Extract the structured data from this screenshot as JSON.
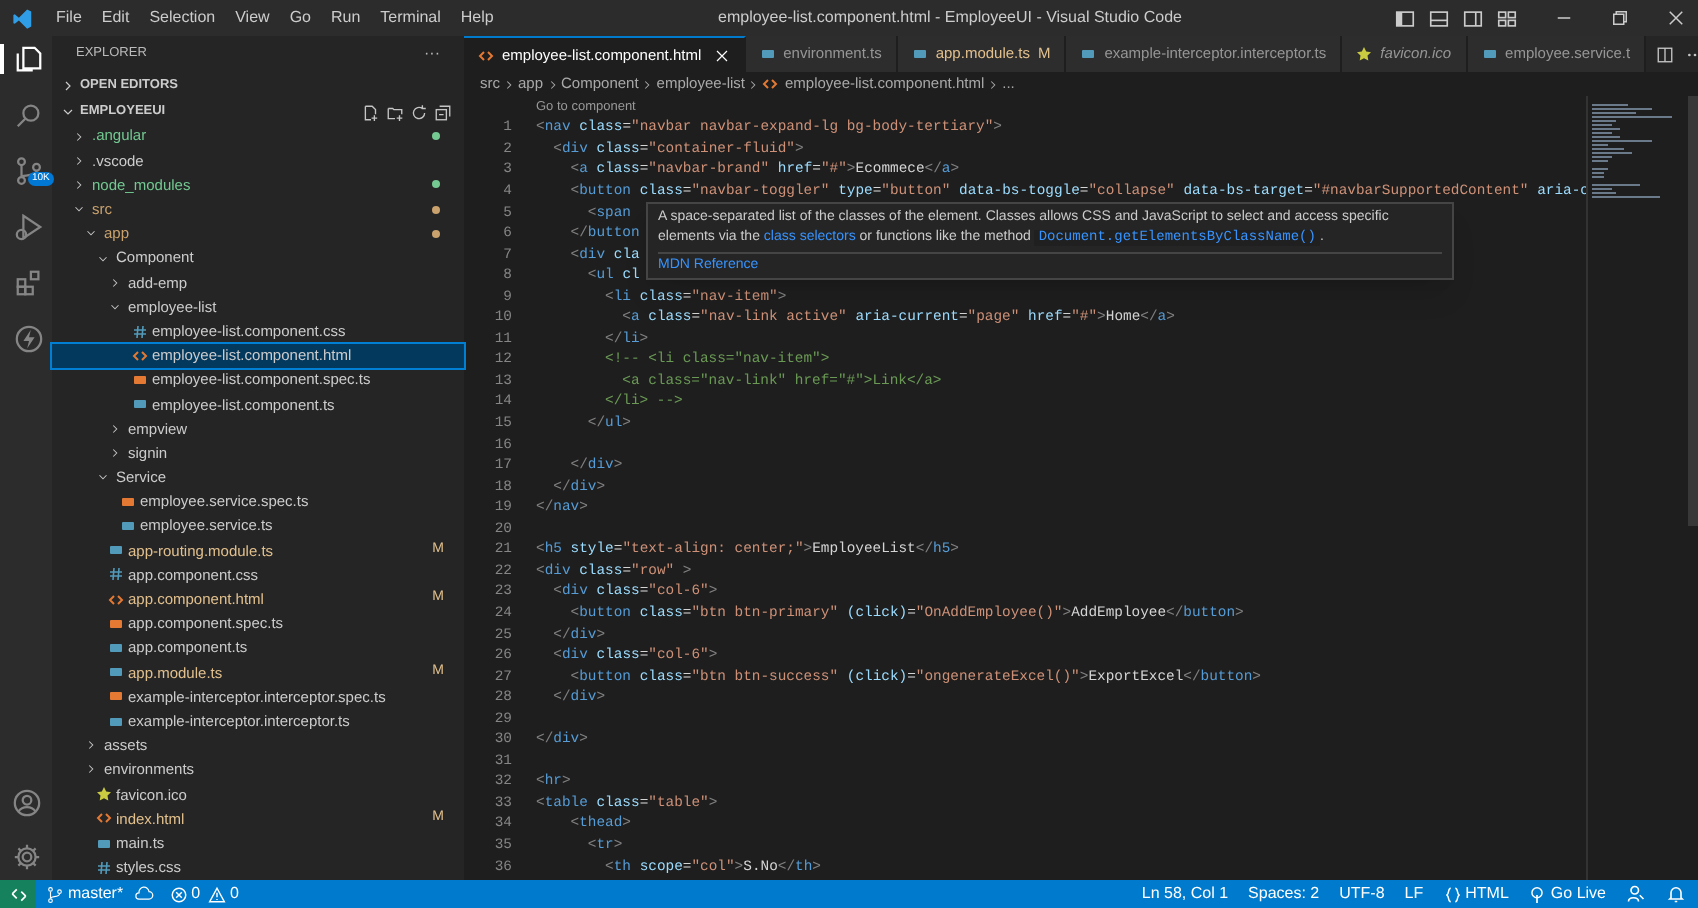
{
  "menu": [
    "File",
    "Edit",
    "Selection",
    "View",
    "Go",
    "Run",
    "Terminal",
    "Help"
  ],
  "window": {
    "title": "employee-list.component.html - EmployeeUI - Visual Studio Code"
  },
  "activity_bar": {
    "items": [
      {
        "selected": true
      },
      {
        "selected": false
      },
      {
        "selected": false,
        "badge": "10K"
      },
      {
        "selected": false
      },
      {
        "selected": false
      },
      {
        "selected": false
      }
    ]
  },
  "sidebar": {
    "title": "EXPLORER",
    "more": "···",
    "sections": [
      {
        "label": "OPEN EDITORS",
        "expanded": false
      },
      {
        "label": "EMPLOYEEUI",
        "expanded": true
      }
    ],
    "tree": [
      {
        "label": ".angular",
        "kind": "folder",
        "expanded": false,
        "color": "#73c991",
        "dot": true
      },
      {
        "label": ".vscode",
        "kind": "folder",
        "expanded": false
      },
      {
        "label": "node_modules",
        "kind": "folder",
        "expanded": false,
        "color": "#73c991",
        "dot": true
      },
      {
        "label": "src",
        "kind": "folder",
        "expanded": true,
        "color": "#c9a26d",
        "dot": true,
        "children": [
          {
            "label": "app",
            "kind": "folder",
            "expanded": true,
            "color": "#c9a26d",
            "dot": true,
            "children": [
              {
                "label": "Component",
                "kind": "folder",
                "expanded": true,
                "children": [
                  {
                    "label": "add-emp",
                    "kind": "folder",
                    "expanded": false
                  },
                  {
                    "label": "employee-list",
                    "kind": "folder",
                    "expanded": true,
                    "children": [
                      {
                        "label": "employee-list.component.css",
                        "kind": "css",
                        "selected": false
                      },
                      {
                        "label": "employee-list.component.html",
                        "kind": "html",
                        "selected": true
                      },
                      {
                        "label": "employee-list.component.spec.ts",
                        "kind": "spec",
                        "selected": false
                      },
                      {
                        "label": "employee-list.component.ts",
                        "kind": "ts",
                        "selected": false
                      }
                    ]
                  },
                  {
                    "label": "empview",
                    "kind": "folder",
                    "expanded": false
                  },
                  {
                    "label": "signin",
                    "kind": "folder",
                    "expanded": false
                  }
                ]
              },
              {
                "label": "Service",
                "kind": "folder",
                "expanded": true,
                "children": [
                  {
                    "label": "employee.service.spec.ts",
                    "kind": "spec",
                    "selected": false
                  },
                  {
                    "label": "employee.service.ts",
                    "kind": "ts",
                    "selected": false
                  }
                ]
              },
              {
                "label": "app-routing.module.ts",
                "kind": "ts",
                "selected": false,
                "color": "#e2c08d",
                "badge": "M"
              },
              {
                "label": "app.component.css",
                "kind": "css",
                "selected": false
              },
              {
                "label": "app.component.html",
                "kind": "html",
                "selected": false,
                "color": "#e2c08d",
                "badge": "M"
              },
              {
                "label": "app.component.spec.ts",
                "kind": "spec",
                "selected": false
              },
              {
                "label": "app.component.ts",
                "kind": "ts",
                "selected": false
              },
              {
                "label": "app.module.ts",
                "kind": "ts",
                "selected": false,
                "color": "#e2c08d",
                "badge": "M"
              },
              {
                "label": "example-interceptor.interceptor.spec.ts",
                "kind": "spec",
                "selected": false
              },
              {
                "label": "example-interceptor.interceptor.ts",
                "kind": "ts",
                "selected": false
              }
            ]
          },
          {
            "label": "assets",
            "kind": "folder",
            "expanded": false
          },
          {
            "label": "environments",
            "kind": "folder",
            "expanded": false
          },
          {
            "label": "favicon.ico",
            "kind": "star",
            "selected": false
          },
          {
            "label": "index.html",
            "kind": "html",
            "selected": false,
            "color": "#e2c08d",
            "badge": "M"
          },
          {
            "label": "main.ts",
            "kind": "ts",
            "selected": false
          },
          {
            "label": "styles.css",
            "kind": "css",
            "selected": false
          }
        ]
      }
    ]
  },
  "tabs": [
    {
      "label": "employee-list.component.html",
      "kind": "html",
      "selected": true,
      "preview": false
    },
    {
      "label": "environment.ts",
      "kind": "ts",
      "selected": false,
      "preview": false
    },
    {
      "label": "app.module.ts",
      "kind": "ts",
      "selected": false,
      "preview": false,
      "badge": "M"
    },
    {
      "label": "example-interceptor.interceptor.ts",
      "kind": "ts",
      "selected": false,
      "preview": false
    },
    {
      "label": "favicon.ico",
      "kind": "star",
      "selected": false,
      "preview": true
    },
    {
      "label": "employee.service.t",
      "kind": "ts",
      "selected": false,
      "preview": false
    }
  ],
  "breadcrumb": [
    "src",
    "app",
    "Component",
    "employee-list",
    "employee-list.component.html",
    "..."
  ],
  "codelens": "Go to component",
  "code_lines": [
    {
      "number": "1",
      "text": "<nav class=\"navbar navbar-expand-lg bg-body-tertiary\">"
    },
    {
      "number": "2",
      "text": "  <div class=\"container-fluid\">"
    },
    {
      "number": "3",
      "text": "    <a class=\"navbar-brand\" href=\"#\">Ecommece</a>"
    },
    {
      "number": "4",
      "text": "    <button class=\"navbar-toggler\" type=\"button\" data-bs-toggle=\"collapse\" data-bs-target=\"#navbarSupportedContent\" aria-c"
    },
    {
      "number": "5",
      "text": "      <span"
    },
    {
      "number": "6",
      "text": "    </button"
    },
    {
      "number": "7",
      "text": "    <div cla"
    },
    {
      "number": "8",
      "text": "      <ul cl"
    },
    {
      "number": "9",
      "text": "        <li class=\"nav-item\">"
    },
    {
      "number": "10",
      "text": "          <a class=\"nav-link active\" aria-current=\"page\" href=\"#\">Home</a>"
    },
    {
      "number": "11",
      "text": "        </li>"
    },
    {
      "number": "12",
      "text": "        <!-- <li class=\"nav-item\">"
    },
    {
      "number": "13",
      "text": "          <a class=\"nav-link\" href=\"#\">Link</a>"
    },
    {
      "number": "14",
      "text": "        </li> -->"
    },
    {
      "number": "15",
      "text": "      </ul>"
    },
    {
      "number": "16"
    },
    {
      "number": "17",
      "text": "    </div>"
    },
    {
      "number": "18",
      "text": "  </div>"
    },
    {
      "number": "19",
      "text": "</nav>"
    },
    {
      "number": "20"
    },
    {
      "number": "21",
      "text": "<h5 style=\"text-align: center;\">EmployeeList</h5>"
    },
    {
      "number": "22",
      "text": "<div class=\"row\" >"
    },
    {
      "number": "23",
      "text": "  <div class=\"col-6\">"
    },
    {
      "number": "24",
      "text": "    <button class=\"btn btn-primary\" (click)=\"OnAddEmployee()\">AddEmployee</button>"
    },
    {
      "number": "25",
      "text": "  </div>"
    },
    {
      "number": "26",
      "text": "  <div class=\"col-6\">"
    },
    {
      "number": "27",
      "text": "    <button class=\"btn btn-success\" (click)=\"ongenerateExcel()\">ExportExcel</button>"
    },
    {
      "number": "28",
      "text": "  </div>"
    },
    {
      "number": "29"
    },
    {
      "number": "30",
      "text": "</div>"
    },
    {
      "number": "31"
    },
    {
      "number": "32",
      "text": "<hr>"
    },
    {
      "number": "33",
      "text": "<table class=\"table\">"
    },
    {
      "number": "34",
      "text": "    <thead>"
    },
    {
      "number": "35",
      "text": "      <tr>"
    },
    {
      "number": "36",
      "text": "        <th scope=\"col\">S.No</th>"
    }
  ],
  "hover": {
    "parts": [
      {
        "kind": "text",
        "text": "A space-separated list of the classes of the element. Classes allows CSS and JavaScript to select and access specific elements via the "
      },
      {
        "kind": "link",
        "text": "class selectors"
      },
      {
        "kind": "text",
        "text": " or functions like the method "
      },
      {
        "kind": "code",
        "text": "Document.getElementsByClassName()"
      },
      {
        "kind": "text",
        "text": "."
      }
    ],
    "reference": "MDN Reference"
  },
  "status_bar": {
    "branch": "master*",
    "errors": "0",
    "warnings": "0",
    "right": [
      {
        "kind": "text",
        "text": "Ln 58, Col 1"
      },
      {
        "kind": "text",
        "text": "Spaces: 2"
      },
      {
        "kind": "text",
        "text": "UTF-8"
      },
      {
        "kind": "text",
        "text": "LF"
      },
      {
        "kind": "language",
        "text": "HTML"
      },
      {
        "kind": "live",
        "text": "Go Live"
      },
      {
        "kind": "feedback"
      },
      {
        "kind": "bell"
      }
    ]
  }
}
